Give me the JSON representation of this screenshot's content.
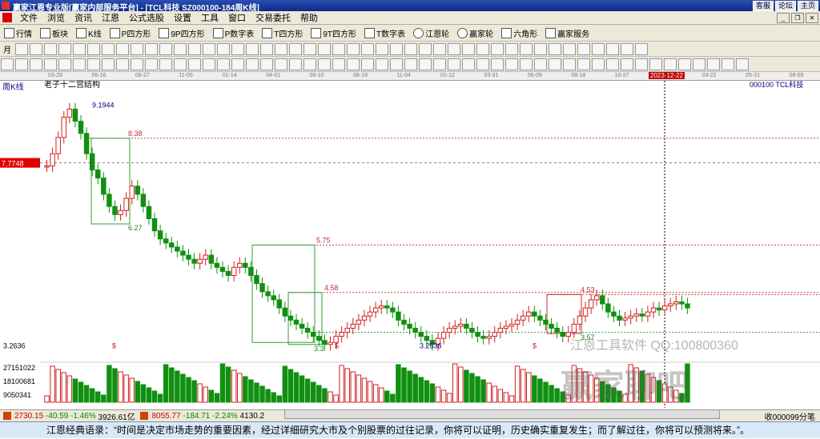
{
  "window": {
    "title": "赢家江恩专业版[赢家内部服务平台] - [TCL科技  SZ000100-184周K线]",
    "right_buttons": [
      "客服",
      "论坛",
      "主页"
    ]
  },
  "menu": [
    "文件",
    "浏览",
    "资讯",
    "江恩",
    "公式选股",
    "设置",
    "工具",
    "窗口",
    "交易委托",
    "帮助"
  ],
  "toolbar1": [
    "行情",
    "板块",
    "K线",
    "P四方形",
    "9P四方形",
    "P数字表",
    "T四方形",
    "9T四方形",
    "T数字表",
    "江恩轮",
    "赢家轮",
    "六角形",
    "赢家服务"
  ],
  "toolbar2_first": "月",
  "datebar": {
    "dates": [
      "03-29",
      "06-16",
      "08-27",
      "11-05",
      "01-14",
      "04-01",
      "06-10",
      "08-19",
      "11-04",
      "01-12",
      "03-31",
      "06-09",
      "08-18",
      "10-27",
      "01-05",
      "03-22",
      "05-31",
      "08-09"
    ],
    "highlight": "2023-12-22"
  },
  "chart": {
    "period_label": "周K线",
    "indicator": "老子十二宫结构",
    "security": "000100  TCL科技",
    "price_marker": "7.7748",
    "levels": [
      "9.1944",
      "8.38",
      "6.27",
      "5.75",
      "4.58",
      "4.53",
      "3.3",
      "3.57",
      "3.2636"
    ],
    "left_low": "3.2636",
    "volume_labels": [
      "27151022",
      "18100681",
      "9050341"
    ],
    "dollar_marks": [
      "$",
      "$",
      "$"
    ],
    "watermark_company": "江恩工具软件 QQ:100800360",
    "watermark_brand": "赢家聊吧"
  },
  "status": {
    "sh_index": "2730.15",
    "sh_change": "-40.59",
    "sh_pct": "-1.46%",
    "sh_amount": "3926.61亿",
    "sz_index": "8055.77",
    "sz_change": "-184.71",
    "sz_pct": "-2.24%",
    "sz_amount": "4130.2",
    "right": "收000099分笔"
  },
  "quote_text": "江恩经典语录：“时间是决定市场走势的重要因素，经过详细研究大市及个别股票的过往记录，你将可以证明，历史确实重复发生；而了解过往，你将可以预测将来。”。",
  "chart_data": {
    "type": "candlestick",
    "title": "老子十二宫结构",
    "series": [
      {
        "name": "000100 TCL科技",
        "values": [
          7.7,
          8.0,
          8.4,
          8.9,
          9.1,
          8.8,
          8.5,
          8.0,
          7.6,
          7.4,
          7.0,
          6.7,
          6.5,
          6.6,
          6.9,
          7.2,
          7.0,
          6.7,
          6.4,
          6.1,
          5.9,
          5.8,
          5.7,
          5.6,
          5.5,
          5.4,
          5.3,
          5.4,
          5.5,
          5.3,
          5.2,
          5.1,
          5.0,
          5.2,
          5.3,
          5.2,
          5.0,
          4.8,
          4.6,
          4.5,
          4.4,
          4.2,
          4.0,
          3.9,
          3.8,
          3.7,
          3.6,
          3.5,
          3.4,
          3.3,
          3.35,
          3.5,
          3.6,
          3.7,
          3.8,
          3.9,
          4.0,
          4.1,
          4.2,
          4.25,
          4.2,
          4.1,
          3.9,
          3.8,
          3.7,
          3.6,
          3.5,
          3.4,
          3.3,
          3.45,
          3.6,
          3.7,
          3.75,
          3.8,
          3.7,
          3.6,
          3.5,
          3.45,
          3.5,
          3.6,
          3.7,
          3.75,
          3.8,
          3.9,
          4.0,
          4.1,
          4.0,
          3.9,
          3.8,
          3.7,
          3.6,
          3.5,
          3.6,
          3.8,
          4.0,
          4.2,
          4.4,
          4.5,
          4.3,
          4.1,
          4.0,
          3.9,
          3.95,
          4.0,
          4.05,
          4.0,
          4.1,
          4.2,
          4.15,
          4.25,
          4.3,
          4.35,
          4.3,
          4.2
        ]
      }
    ]
  }
}
